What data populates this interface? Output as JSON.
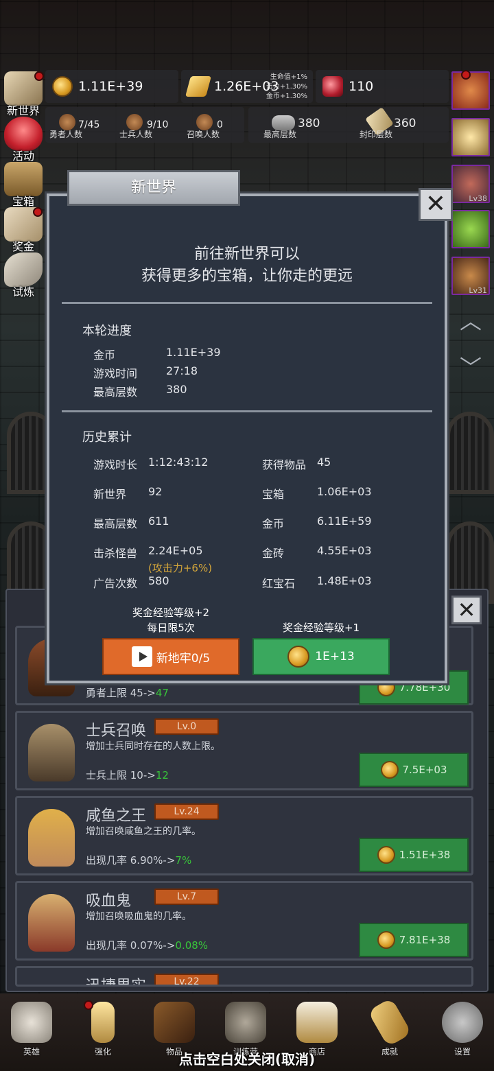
{
  "resources": {
    "coins": "1.11E+39",
    "gold_bars": "1.26E+03",
    "gold_bar_bonus": [
      "生命值+1%",
      "击力+1.30%",
      "金币+1.30%"
    ],
    "rubies": "110"
  },
  "stats": {
    "heroes_value": "7/45",
    "heroes_label": "勇者人数",
    "soldiers_value": "9/10",
    "soldiers_label": "士兵人数",
    "summons_value": "0",
    "summons_label": "召唤人数",
    "max_floor_value": "380",
    "max_floor_label": "最高层数",
    "seal_floor_value": "360",
    "seal_floor_label": "封印层数"
  },
  "left_menu": {
    "new_world": "新世界",
    "events": "活动",
    "chest": "宝箱",
    "reward": "奖金",
    "trial": "试炼"
  },
  "right_slots": {
    "lv3": "Lv38",
    "lv5": "Lv31"
  },
  "modal": {
    "tab_title": "新世界",
    "intro_line1": "前往新世界可以",
    "intro_line2": "获得更多的宝箱，让你走的更远",
    "round_title": "本轮进度",
    "round": {
      "coin_label": "金币",
      "coin_value": "1.11E+39",
      "time_label": "游戏时间",
      "time_value": "27:18",
      "floor_label": "最高层数",
      "floor_value": "380"
    },
    "history_title": "历史累计",
    "history": {
      "duration_label": "游戏时长",
      "duration_value": "1:12:43:12",
      "items_label": "获得物品",
      "items_value": "45",
      "newworld_label": "新世界",
      "newworld_value": "92",
      "chest_label": "宝箱",
      "chest_value": "1.06E+03",
      "floor_label": "最高层数",
      "floor_value": "611",
      "coin_label": "金币",
      "coin_value": "6.11E+59",
      "kills_label": "击杀怪兽",
      "kills_value": "2.24E+05",
      "kills_note": "(攻击力+6%)",
      "bricks_label": "金砖",
      "bricks_value": "4.55E+03",
      "ads_label": "广告次数",
      "ads_value": "580",
      "ruby_label": "红宝石",
      "ruby_value": "1.48E+03"
    },
    "ad_caption1": "奖金经验等级+2",
    "ad_caption2": "每日限5次",
    "ad_button": "新地牢0/5",
    "coin_caption": "奖金经验等级+1",
    "coin_button": "1E+13"
  },
  "cards": [
    {
      "partial_effect": "勇者上限 45->",
      "partial_effect_new": "47",
      "price": "7.78E+30"
    },
    {
      "name": "士兵召唤",
      "level": "Lv.0",
      "desc": "增加士兵同时存在的人数上限。",
      "effect": "士兵上限 10->",
      "effect_new": "12",
      "price": "7.5E+03"
    },
    {
      "name": "咸鱼之王",
      "level": "Lv.24",
      "desc": "增加召唤咸鱼之王的几率。",
      "effect": "出现几率 6.90%->",
      "effect_new": "7%",
      "price": "1.51E+38"
    },
    {
      "name": "吸血鬼",
      "level": "Lv.7",
      "desc": "增加召唤吸血鬼的几率。",
      "effect": "出现几率 0.07%->",
      "effect_new": "0.08%",
      "price": "7.81E+38"
    },
    {
      "name": "迅捷果实",
      "level": "Lv.22"
    }
  ],
  "nav": [
    "英雄",
    "强化",
    "物品",
    "训练营",
    "商店",
    "成就",
    "设置"
  ],
  "hint": "点击空白处关闭(取消)"
}
